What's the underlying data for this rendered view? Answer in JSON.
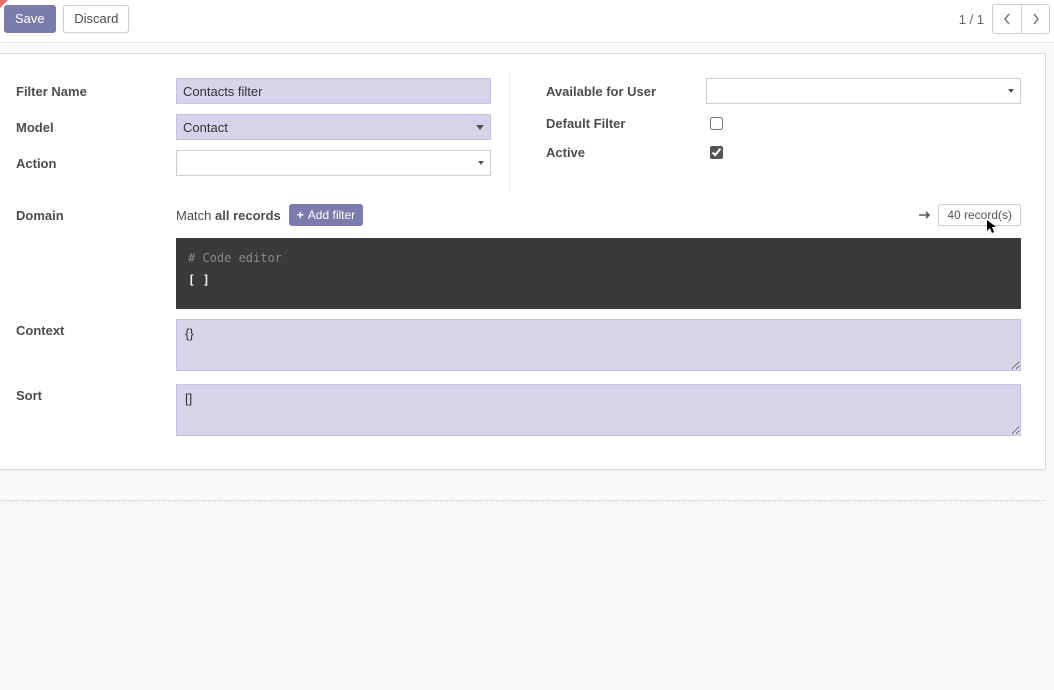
{
  "toolbar": {
    "save_label": "Save",
    "discard_label": "Discard",
    "pager_text": "1 / 1"
  },
  "form": {
    "left": {
      "filter_name_label": "Filter Name",
      "filter_name_value": "Contacts filter",
      "model_label": "Model",
      "model_value": "Contact",
      "action_label": "Action",
      "action_value": ""
    },
    "right": {
      "available_user_label": "Available for User",
      "available_user_value": "",
      "default_filter_label": "Default Filter",
      "default_filter_checked": false,
      "active_label": "Active",
      "active_checked": true
    }
  },
  "domain": {
    "label": "Domain",
    "match_prefix": "Match ",
    "match_bold": "all records",
    "add_filter_label": "Add filter",
    "records_label": "40 record(s)",
    "code_comment": "# Code editor",
    "code_value": "[ ]"
  },
  "context": {
    "label": "Context",
    "value": "{}"
  },
  "sort": {
    "label": "Sort",
    "value": "[]"
  }
}
